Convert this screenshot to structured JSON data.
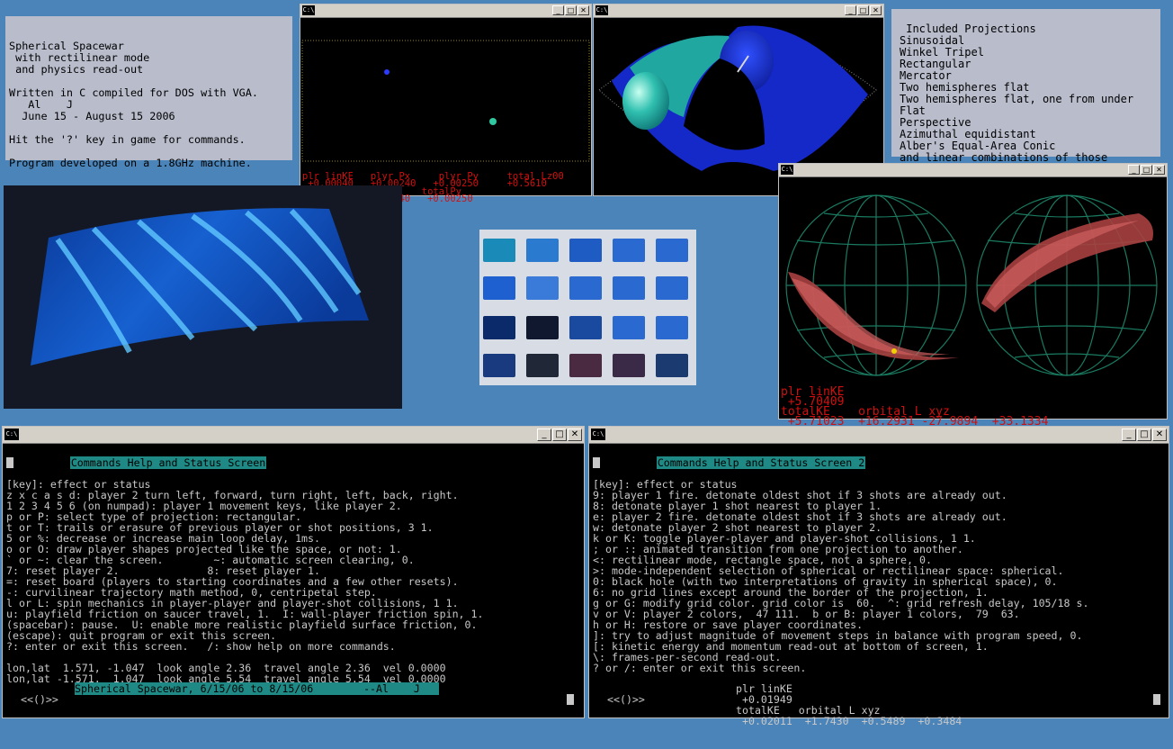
{
  "info_panel": {
    "lines": [
      "Spherical Spacewar",
      " with rectilinear mode",
      " and physics read-out",
      "",
      "Written in C compiled for DOS with VGA.",
      "   Al    J",
      "  June 15 - August 15 2006",
      "",
      "Hit the '?' key in game for commands.",
      "",
      "Program developed on a 1.8GHz machine."
    ]
  },
  "projections_panel": {
    "title": " Included Projections",
    "items": [
      "Sinusoidal",
      "Winkel Tripel",
      "Rectangular",
      "Mercator",
      "Two hemispheres flat",
      "Two hemispheres flat, one from under",
      "Flat",
      "Perspective",
      "Azimuthal equidistant",
      "Alber's Equal-Area Conic",
      "and linear combinations of those"
    ]
  },
  "window_icon": "C:\\",
  "window_buttons": {
    "min": "_",
    "max": "□",
    "close": "✕"
  },
  "win_rect": {
    "readout_line1": "plr linKE   plyr Px     plyr Py     total Lz00",
    "readout_line2": " +0.00040   +0.00240   +0.00250     +0.5610",
    "readout_line3": "totalKE   totalPx    totalPy",
    "readout_line4": " +0.00040  +0.00240   +0.00250"
  },
  "win_hemi": {
    "readout_line1": "plr linKE",
    "readout_line2": " +5.70409",
    "readout_line3": "totalKE    orbital L xyz",
    "readout_line4": " +5.71023  +16.2931 -27.9894  +33.1334"
  },
  "help1": {
    "header": "Commands Help and Status Screen",
    "lines": [
      "[key]: effect or status",
      "z x c a s d: player 2 turn left, forward, turn right, left, back, right.",
      "1 2 3 4 5 6 (on numpad): player 1 movement keys, like player 2.",
      "p or P: select type of projection: rectangular.",
      "t or T: trails or erasure of previous player or shot positions, 3 1.",
      "5 or %: decrease or increase main loop delay, 1ms.",
      "o or O: draw player shapes projected like the space, or not: 1.",
      "` or ~: clear the screen.        ~: automatic screen clearing, 0.",
      "7: reset player 2.              8: reset player 1.",
      "=: reset board (players to starting coordinates and a few other resets).",
      "-: curvilinear trajectory math method, 0, centripetal step.",
      "l or L: spin mechanics in player-player and player-shot collisions, 1 1.",
      "u: playfield friction on saucer travel, 1.  I: wall-player friction spin, 1.",
      "(spacebar): pause.  U: enable more realistic playfield surface friction, 0.",
      "(escape): quit program or exit this screen.",
      "?: enter or exit this screen.   /: show help on more commands.",
      "",
      "lon,lat  1.571, -1.047  look angle 2.36  travel angle 2.36  vel 0.0000",
      "lon,lat -1.571,  1.047  look angle 5.54  travel angle 5.54  vel 0.0000"
    ],
    "scroll_marker": "<<()>>",
    "status": "Spherical Spacewar, 6/15/06 to 8/15/06        --Al    J   "
  },
  "help2": {
    "header": "Commands Help and Status Screen 2",
    "lines": [
      "[key]: effect or status",
      "9: player 1 fire. detonate oldest shot if 3 shots are already out.",
      "8: detonate player 1 shot nearest to player 1.",
      "e: player 2 fire. detonate oldest shot if 3 shots are already out.",
      "w: detonate player 2 shot nearest to player 2.",
      "k or K: toggle player-player and player-shot collisions, 1 1.",
      "; or :: animated transition from one projection to another.",
      "<: rectilinear mode, rectangle space, not a sphere, 0.",
      ">: mode-independent selection of spherical or rectilinear space: spherical.",
      "0: black hole (with two interpretations of gravity in spherical space), 0.",
      "6: no grid lines except around the border of the projection, 1.",
      "g or G: modify grid color. grid color is  60.  ^: grid refresh delay, 105/18 s.",
      "v or V: player 2 colors,  47 111.  b or B: player 1 colors,  79  63.",
      "h or H: restore or save player coordinates.",
      "]: try to adjust magnitude of movement steps in balance with program speed, 0.",
      "[: kinetic energy and momentum read-out at bottom of screen, 1.",
      "\\: frames-per-second read-out.",
      "? or /: enter or exit this screen."
    ],
    "readout_line1": "plr linKE",
    "readout_line2": " +0.01949",
    "readout_line3": "totalKE   orbital L xyz",
    "readout_line4": " +0.02011  +1.7430  +0.5489  +0.3484",
    "scroll_marker": "<<()>>"
  }
}
